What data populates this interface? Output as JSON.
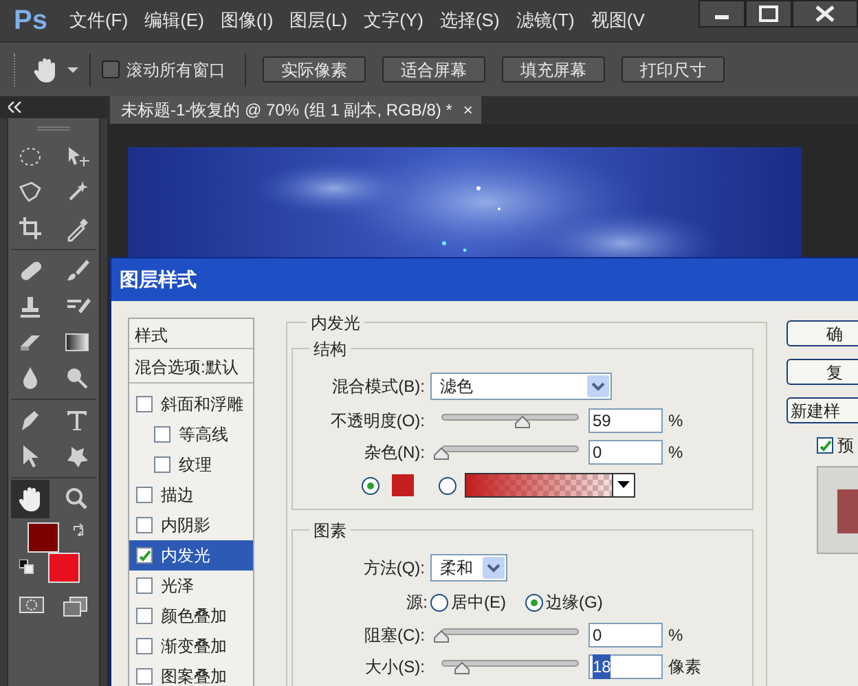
{
  "app": {
    "logo": "Ps",
    "menu": [
      "文件(F)",
      "编辑(E)",
      "图像(I)",
      "图层(L)",
      "文字(Y)",
      "选择(S)",
      "滤镜(T)",
      "视图(V"
    ]
  },
  "options_bar": {
    "scroll_all": {
      "label": "滚动所有窗口",
      "checked": false
    },
    "buttons": [
      "实际像素",
      "适合屏幕",
      "填充屏幕",
      "打印尺寸"
    ]
  },
  "document_tab": {
    "title": "未标题-1-恢复的 @ 70% (组 1 副本, RGB/8) *",
    "close": "×"
  },
  "tools": [
    {
      "selected": false
    },
    {
      "selected": false
    },
    {
      "selected": false
    },
    {
      "selected": false
    },
    {
      "selected": false
    },
    {
      "selected": false
    },
    {
      "selected": false
    },
    {
      "selected": false
    },
    {
      "selected": false
    },
    {
      "selected": false
    },
    {
      "selected": false
    },
    {
      "selected": false
    },
    {
      "selected": false
    },
    {
      "selected": false
    },
    {
      "selected": false
    },
    {
      "selected": false
    },
    {
      "selected": false
    },
    {
      "selected": false
    },
    {
      "selected": true
    },
    {
      "selected": false
    }
  ],
  "swatches": [
    {
      "color": "#7d0000"
    },
    {
      "color": "#e8101e"
    }
  ],
  "dialog": {
    "title": "图层样式",
    "styles_list": {
      "header": "样式",
      "blend_options": "混合选项:默认",
      "items": [
        {
          "label": "斜面和浮雕",
          "checked": false,
          "selected": false,
          "children": [
            {
              "label": "等高线",
              "checked": false,
              "selected": false
            },
            {
              "label": "纹理",
              "checked": false,
              "selected": false
            }
          ]
        },
        {
          "label": "描边",
          "checked": false,
          "selected": false
        },
        {
          "label": "内阴影",
          "checked": false,
          "selected": false
        },
        {
          "label": "内发光",
          "checked": true,
          "selected": true
        },
        {
          "label": "光泽",
          "checked": false,
          "selected": false
        },
        {
          "label": "颜色叠加",
          "checked": false,
          "selected": false
        },
        {
          "label": "渐变叠加",
          "checked": false,
          "selected": false
        },
        {
          "label": "图案叠加",
          "checked": false,
          "selected": false
        }
      ]
    },
    "section_title": "内发光",
    "structure": {
      "title": "结构",
      "blend_mode": {
        "label": "混合模式(B):",
        "value": "滤色"
      },
      "sliders": [
        {
          "label": "不透明度(O):",
          "level": 0.59,
          "value": "59",
          "unit": "%",
          "value_selected": false
        },
        {
          "label": "杂色(N):",
          "level": 0,
          "value": "0",
          "unit": "%",
          "value_selected": false
        }
      ],
      "fill": [
        {
          "kind": "color",
          "selected": true,
          "color": "#c41e1e"
        },
        {
          "kind": "gradient",
          "selected": false,
          "color": "#c41e1e"
        }
      ]
    },
    "elements": {
      "title": "图素",
      "method": {
        "label": "方法(Q):",
        "value": "柔和"
      },
      "source": {
        "label": "源:",
        "options": [
          {
            "label": "居中(E)",
            "selected": false
          },
          {
            "label": "边缘(G)",
            "selected": true
          }
        ]
      },
      "sliders": [
        {
          "label": "阻塞(C):",
          "level": 0,
          "value": "0",
          "unit": "%",
          "value_selected": false
        },
        {
          "label": "大小(S):",
          "level": 0.15,
          "value": "18",
          "unit": "像素",
          "value_selected": true
        }
      ]
    },
    "buttons": [
      "确",
      "复",
      "新建样"
    ],
    "preview": {
      "label": "预",
      "checked": true
    }
  }
}
